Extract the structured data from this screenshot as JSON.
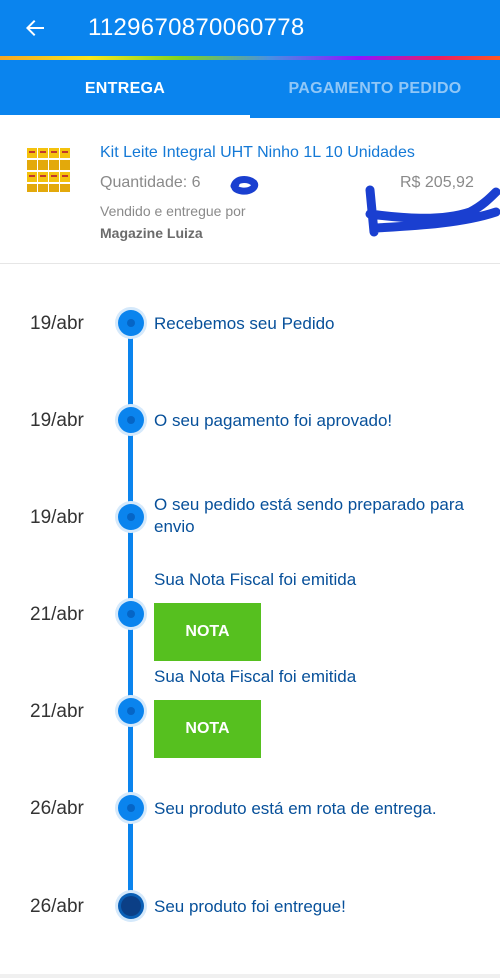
{
  "header": {
    "order_number": "1129670870060778",
    "back_icon": "arrow-back-icon",
    "background": "#0a84ee"
  },
  "tabs": [
    {
      "label": "ENTREGA",
      "active": true
    },
    {
      "label": "PAGAMENTO PEDIDO",
      "active": false
    }
  ],
  "product": {
    "name": "Kit Leite Integral UHT Ninho 1L 10 Unidades",
    "quantity": "Quantidade: 6",
    "price": "R$ 205,92",
    "seller_label": "Vendido e entregue por",
    "seller_name": "Magazine Luiza"
  },
  "timeline": [
    {
      "date": "19/abr",
      "text": "Recebemos seu Pedido"
    },
    {
      "date": "19/abr",
      "text": "O seu pagamento foi aprovado!"
    },
    {
      "date": "19/abr",
      "text": "O seu pedido está sendo preparado para envio"
    },
    {
      "date": "21/abr",
      "text": "Sua Nota Fiscal foi emitida",
      "button": "NOTA"
    },
    {
      "date": "21/abr",
      "text": "Sua Nota Fiscal foi emitida",
      "button": "NOTA"
    },
    {
      "date": "26/abr",
      "text": "Seu produto está em rota de entrega."
    },
    {
      "date": "26/abr",
      "text": "Seu produto foi entregue!"
    }
  ],
  "colors": {
    "accent": "#0a84ee",
    "nota_button": "#56c01f",
    "timeline_text": "#07509a"
  }
}
